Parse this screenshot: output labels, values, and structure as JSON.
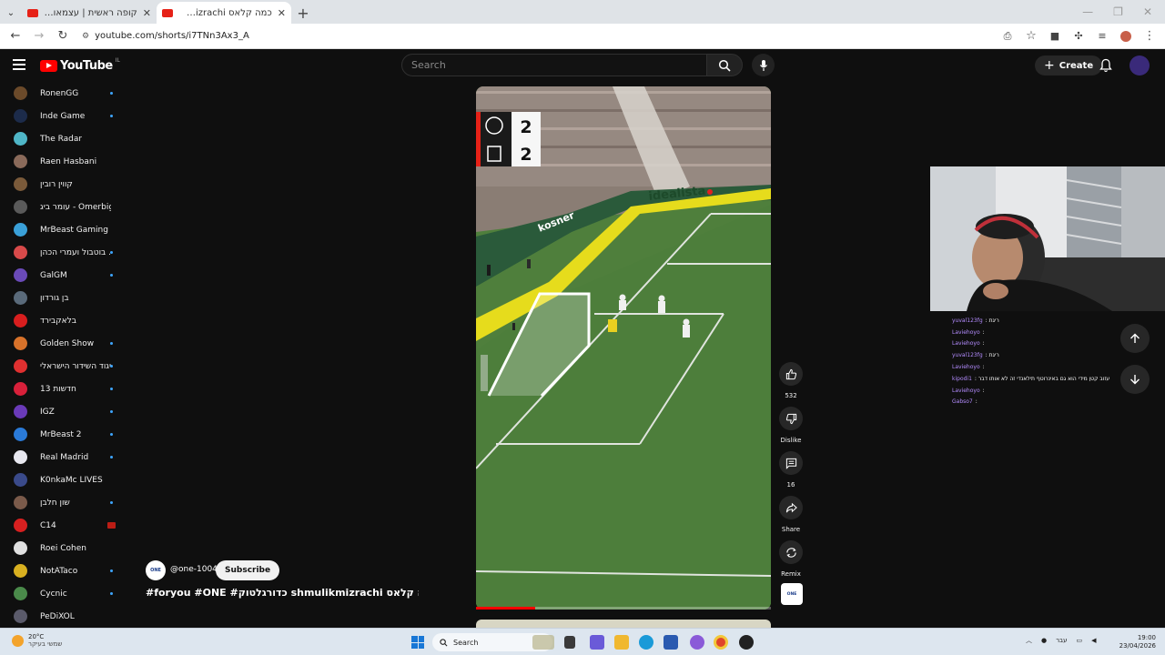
{
  "browser": {
    "tabs": [
      {
        "title": "קופה ראשית | עצמאות כוכבה",
        "active": false
      },
      {
        "title": "כמה קלאס shmulikmizrachi #כ...",
        "active": true
      }
    ],
    "url": "youtube.com/shorts/i7TNn3Ax3_A"
  },
  "youtube": {
    "logo_text": "YouTube",
    "country_code": "IL",
    "search_placeholder": "Search",
    "create_label": "Create"
  },
  "sidebar": {
    "subscriptions": [
      {
        "name": "RonenGG",
        "color": "#6b4a2a",
        "indicator": "dot"
      },
      {
        "name": "Inde Game",
        "color": "#1c2b4a",
        "indicator": "dot"
      },
      {
        "name": "The Radar",
        "color": "#4fb6c7",
        "indicator": "none"
      },
      {
        "name": "Raen Hasbani",
        "color": "#8a6a5a",
        "indicator": "none"
      },
      {
        "name": "קווין רובין",
        "color": "#7a5a3a",
        "indicator": "none"
      },
      {
        "name": "עומר ביג - Omerbig",
        "color": "#5a5a5a",
        "indicator": "none"
      },
      {
        "name": "MrBeast Gaming",
        "color": "#3aa0d8",
        "indicator": "none"
      },
      {
        "name": "בוטבול ועמרי הכהן ...",
        "color": "#d84a4a",
        "indicator": "dot"
      },
      {
        "name": "GalGM",
        "color": "#6a4ab8",
        "indicator": "dot"
      },
      {
        "name": "בן גורדון",
        "color": "#5a6a7a",
        "indicator": "none"
      },
      {
        "name": "בלאקבירד",
        "color": "#d81e1e",
        "indicator": "none"
      },
      {
        "name": "Golden Show",
        "color": "#d8722a",
        "indicator": "dot"
      },
      {
        "name": "איגוד השידור הישראלי...",
        "color": "#e03030",
        "indicator": "dot"
      },
      {
        "name": "חדשות 13",
        "color": "#d8203a",
        "indicator": "dot"
      },
      {
        "name": "IGZ",
        "color": "#6a3ab8",
        "indicator": "dot"
      },
      {
        "name": "MrBeast 2",
        "color": "#2a7ad8",
        "indicator": "dot"
      },
      {
        "name": "Real Madrid",
        "color": "#e8e8f0",
        "indicator": "dot"
      },
      {
        "name": "K0nkaMc LIVES",
        "color": "#3a4a8a",
        "indicator": "none"
      },
      {
        "name": "שון חלבן",
        "color": "#7a5a4a",
        "indicator": "dot"
      },
      {
        "name": "C14",
        "color": "#d82020",
        "indicator": "live"
      },
      {
        "name": "Roei Cohen",
        "color": "#e0e0e0",
        "indicator": "none"
      },
      {
        "name": "NotATaco",
        "color": "#d8b020",
        "indicator": "dot"
      },
      {
        "name": "Cycnic",
        "color": "#4a8a4a",
        "indicator": "dot"
      },
      {
        "name": "PeDiXOL",
        "color": "#5a5a6a",
        "indicator": "none"
      }
    ]
  },
  "short": {
    "channel": "@one-1004",
    "channel_avatar_text": "ONE",
    "subscribe_label": "Subscribe",
    "title": "#foryou #ONE #כדורגלטוק shmulikmizrachi כמה קלאס...",
    "score_top": "2",
    "score_bottom": "2",
    "progress": 0.2,
    "actions": {
      "like_count": "532",
      "dislike_label": "Dislike",
      "comments_count": "16",
      "share_label": "Share",
      "remix_label": "Remix"
    }
  },
  "chat": [
    {
      "user": "yuval123fg",
      "text": ": ריגת"
    },
    {
      "user": "Laviehoyo",
      "text": ":"
    },
    {
      "user": "Laviehoyo",
      "text": ":"
    },
    {
      "user": "yuval123fg",
      "text": ": ריגת"
    },
    {
      "user": "Laviehoyo",
      "text": ":"
    },
    {
      "user": "kipodi1",
      "text": ": עזוב קטן מידי הוא גם באינרוטף תילאנדי זה לא אותו דבר"
    },
    {
      "user": "Laviehoyo",
      "text": ":"
    },
    {
      "user": "Gabso7",
      "text": ":"
    }
  ],
  "taskbar": {
    "weather_temp": "20°C",
    "weather_desc": "שמשי בעיקר",
    "search_label": "Search",
    "lang": "עבר",
    "time": "19:00",
    "date": "23/04/2026"
  }
}
